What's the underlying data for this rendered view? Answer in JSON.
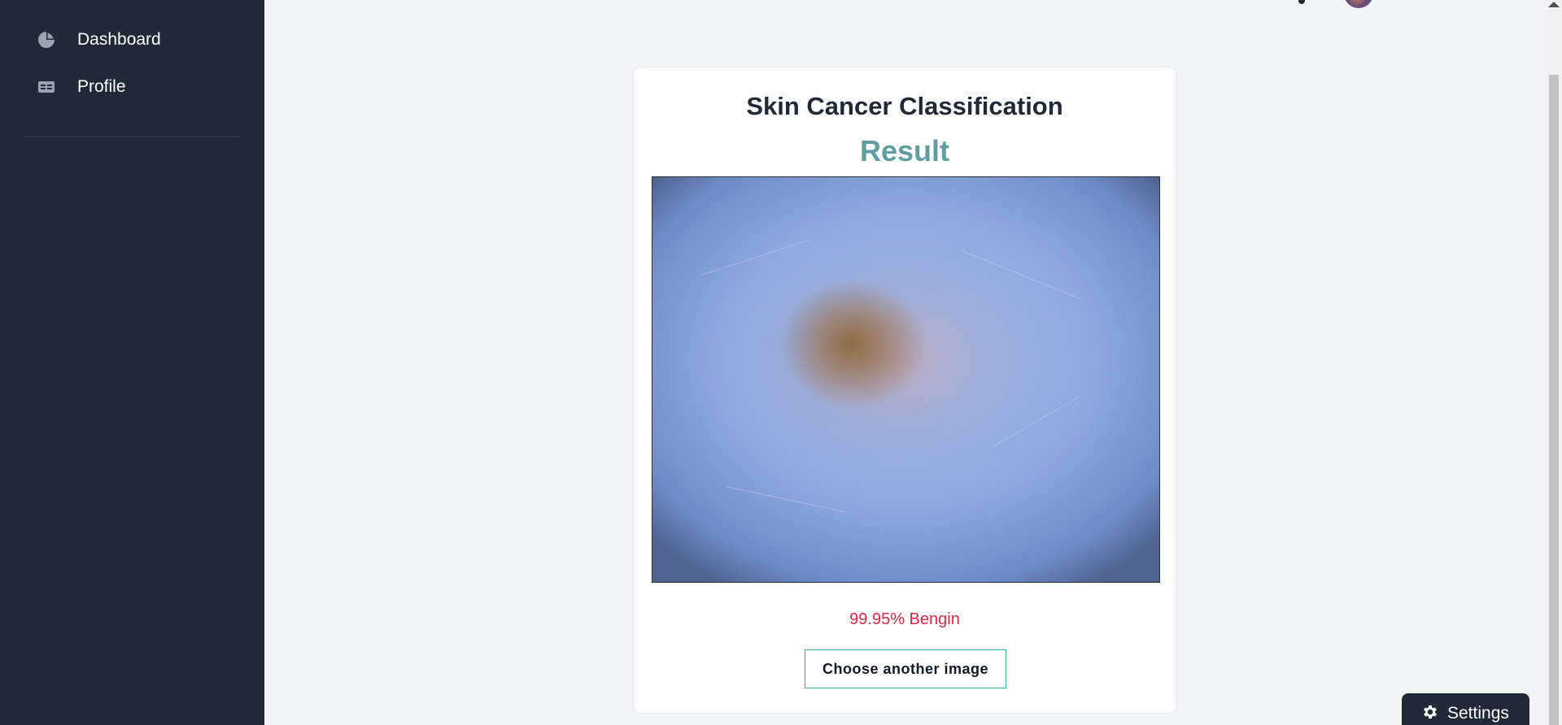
{
  "sidebar": {
    "items": [
      {
        "label": "Dashboard",
        "icon": "pie-chart-icon"
      },
      {
        "label": "Profile",
        "icon": "id-card-icon"
      }
    ]
  },
  "card": {
    "title": "Skin Cancer Classification",
    "subtitle": "Result",
    "image_alt": "dermoscopy lesion image",
    "result": "99.95% Bengin",
    "button_label": "Choose another image"
  },
  "settings": {
    "label": "Settings",
    "icon": "gear-icon"
  },
  "colors": {
    "sidebar_bg": "#1f2937",
    "page_bg": "#f3f4f6",
    "subtitle": "#5f9ea0",
    "result": "#dc2743",
    "button_border": "#34b39a"
  }
}
